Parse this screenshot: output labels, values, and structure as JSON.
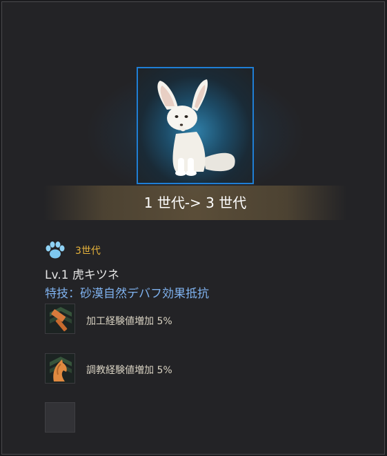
{
  "pet": {
    "generation_change": "1 世代-> 3 世代",
    "generation": "3世代",
    "name": "Lv.1 虎キツネ",
    "special_skill": "特技：砂漠自然デバフ効果抵抗"
  },
  "skills": [
    {
      "icon": "hammer-icon",
      "label": "加工経験値増加 5%"
    },
    {
      "icon": "horse-icon",
      "label": "調教経験値増加 5%"
    }
  ],
  "colors": {
    "portrait_border": "#1f7fd6",
    "generation_accent": "#e8b43c",
    "skill_text": "#7fb2ef"
  }
}
